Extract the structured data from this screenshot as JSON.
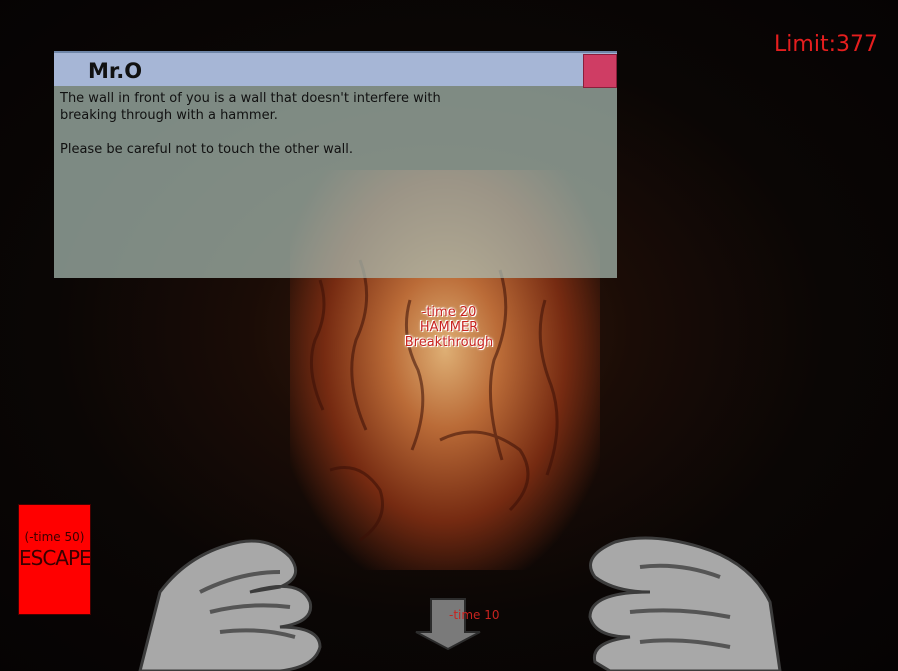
{
  "hud": {
    "limit": "Limit:377"
  },
  "dialog": {
    "title": "Mr.O",
    "lines": [
      "The wall in front of you is a wall that doesn't interfere with breaking through with a hammer.",
      "Please be careful not to touch the other wall."
    ]
  },
  "actions": {
    "hammer": {
      "cost": "-time 20",
      "line1": "HAMMER",
      "line2": "Breakthrough"
    },
    "escape": {
      "cost": "(-time 50)",
      "label": "ESCAPE"
    },
    "back": {
      "cost": "-time 10"
    }
  },
  "colors": {
    "alert_red": "#e51e1e",
    "escape_red": "#ff0000",
    "dialog_header": "#a6b6d6",
    "close_button": "#cf3d64"
  },
  "icons": [
    "down-arrow-icon",
    "left-hand-icon",
    "right-hand-icon"
  ]
}
